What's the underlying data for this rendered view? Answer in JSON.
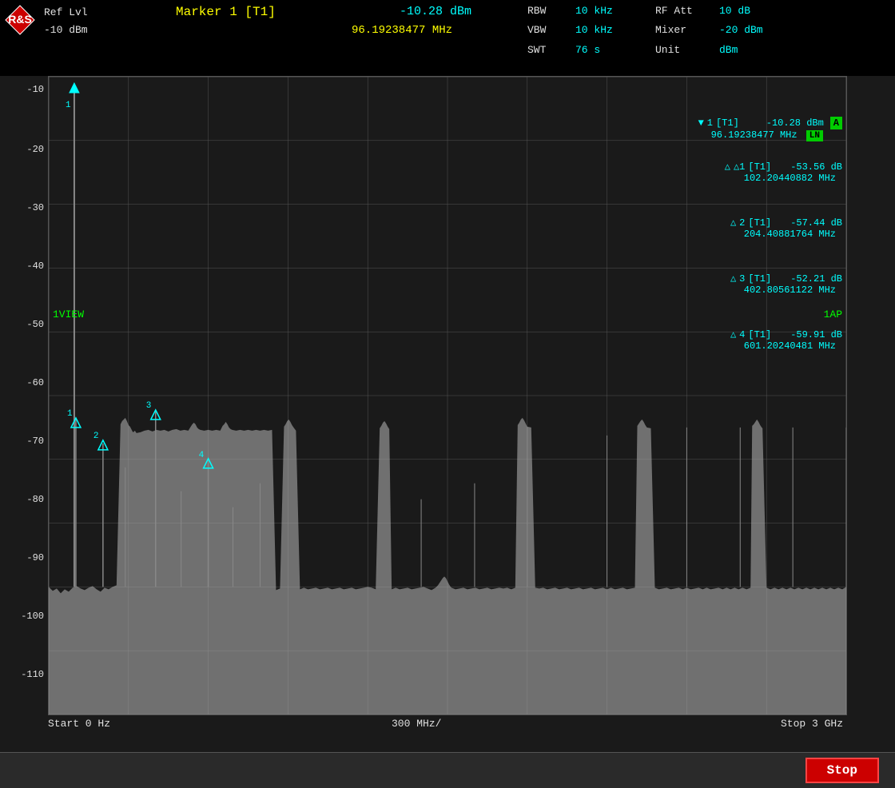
{
  "header": {
    "marker_label": "Marker 1 [T1]",
    "marker_value": "-10.28 dBm",
    "marker_freq": "96.19238477 MHz",
    "rbw_label": "RBW",
    "rbw_value": "10 kHz",
    "rf_att_label": "RF Att",
    "rf_att_value": "10 dB",
    "vbw_label": "VBW",
    "vbw_value": "10 kHz",
    "mixer_label": "Mixer",
    "mixer_value": "-20 dBm",
    "swt_label": "SWT",
    "swt_value": "76 s",
    "unit_label": "Unit",
    "unit_value": "dBm",
    "ref_lvl_label": "Ref Lvl",
    "ref_lvl_sub": "-10 dBm"
  },
  "y_axis": {
    "labels": [
      "-10",
      "-20",
      "-30",
      "-40",
      "-50",
      "-60",
      "-70",
      "-80",
      "-90",
      "-100",
      "-110"
    ]
  },
  "x_axis": {
    "start": "Start 0 Hz",
    "center": "300 MHz/",
    "stop": "Stop 3 GHz"
  },
  "markers": {
    "main": {
      "id": "1",
      "tag": "[T1]",
      "value": "-10.28 dBm",
      "freq": "96.19238477 MHz"
    },
    "delta1": {
      "id": "△1",
      "tag": "[T1]",
      "value": "-53.56 dB",
      "freq": "102.20440882 MHz"
    },
    "delta2": {
      "id": "△2",
      "tag": "[T1]",
      "value": "-57.44 dB",
      "freq": "204.40881764 MHz"
    },
    "delta3": {
      "id": "△3",
      "tag": "[T1]",
      "value": "-52.21 dB",
      "freq": "402.80561122 MHz"
    },
    "delta4": {
      "id": "△4",
      "tag": "[T1]",
      "value": "-59.91 dB",
      "freq": "601.20240481 MHz"
    }
  },
  "badges": {
    "a_badge": "A",
    "ln_badge": "LN",
    "view_label": "1VIEW",
    "ap_label": "1AP"
  },
  "stop_button": {
    "label": "Stop"
  }
}
